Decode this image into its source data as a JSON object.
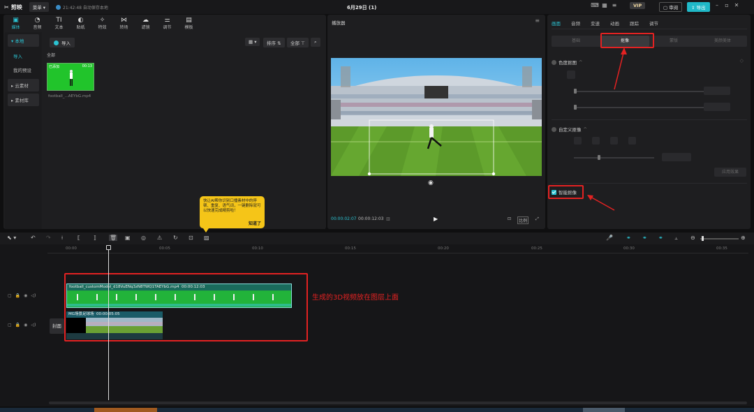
{
  "titlebar": {
    "app_name": "剪映",
    "menu_label": "菜单",
    "autosave": "21:42:48 自动保存本地",
    "project_title": "6月29日 (1)",
    "vip_label": "VIP",
    "review_label": "审阅",
    "export_label": "导出"
  },
  "toolbar": {
    "tools": [
      {
        "label": "媒体",
        "icon": "media-icon"
      },
      {
        "label": "音频",
        "icon": "audio-icon"
      },
      {
        "label": "文本",
        "icon": "text-icon"
      },
      {
        "label": "贴纸",
        "icon": "sticker-icon"
      },
      {
        "label": "特效",
        "icon": "effects-icon"
      },
      {
        "label": "转场",
        "icon": "transition-icon"
      },
      {
        "label": "滤镜",
        "icon": "filter-icon"
      },
      {
        "label": "调节",
        "icon": "adjust-icon"
      },
      {
        "label": "模板",
        "icon": "template-icon"
      }
    ]
  },
  "sidebar": {
    "local": "本地",
    "import": "导入",
    "my_presets": "我的预设",
    "cloud": "云素材",
    "library": "素材库"
  },
  "media": {
    "import_button": "导入",
    "sort_label": "排序",
    "all_filter": "全部",
    "all_label": "全部",
    "thumb_added": "已添加",
    "thumb_duration": "00:13",
    "thumb_name": "football_...AEYbG.mp4"
  },
  "tooltip": {
    "text": "快让AI帮你识别口播素材中的停顿、重复、语气词，一键删除就可以快速完成精剪啦！",
    "ok": "知道了"
  },
  "player": {
    "title": "播放器",
    "current_time": "00:00:02:07",
    "total_time": "00:00:12:03",
    "ratio_label": "比例"
  },
  "props": {
    "tabs": [
      "画面",
      "音频",
      "变速",
      "动画",
      "跟踪",
      "调节"
    ],
    "subtabs": [
      "基础",
      "抠像",
      "蒙版",
      "美颜美体"
    ],
    "chroma_key": "色度抠图",
    "custom_key": "自定义抠像",
    "apply_effect": "应用效果",
    "smart_key": "智能抠像"
  },
  "timeline": {
    "ruler": [
      "00:00",
      "00:05",
      "00:10",
      "00:15",
      "00:20",
      "00:25",
      "00:30",
      "00:35"
    ],
    "clip1_name": "football_customModel_d18VuENq3zN8TWQ1TAEYbG.mp4",
    "clip1_duration": "00:00:12:03",
    "clip2_name": "MG场景足球场",
    "clip2_duration": "00:00:05:05",
    "cover_label": "封面",
    "annotation": "生成的3D视频放在图层上面"
  },
  "colors": {
    "accent": "#2bc3d2",
    "highlight": "#e32222",
    "green_screen": "#21c42b"
  }
}
